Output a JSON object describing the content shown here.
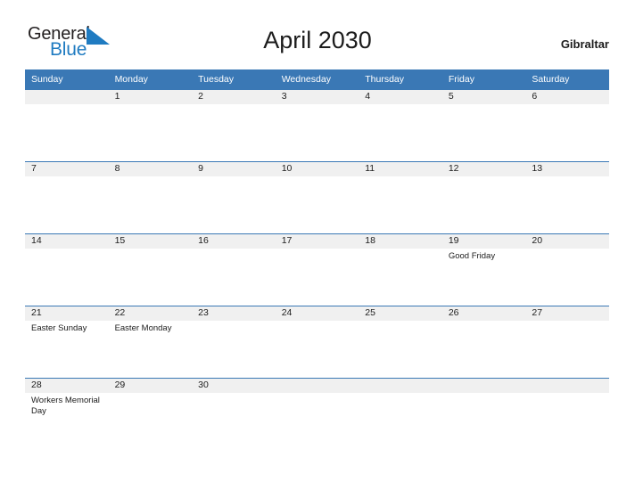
{
  "brand": {
    "line1": "General",
    "line2": "Blue",
    "mark_icon": "flag-triangle-icon",
    "line1_color": "#231f20",
    "line2_color": "#1f7bc1",
    "mark_color": "#1f7bc1"
  },
  "header": {
    "title": "April 2030",
    "location": "Gibraltar"
  },
  "theme": {
    "header_blue": "#3a78b5",
    "date_band_gray": "#f0f0f0",
    "text_dark": "#1c1c1c",
    "page_background": "#ffffff"
  },
  "calendar": {
    "weekday_headers": [
      "Sunday",
      "Monday",
      "Tuesday",
      "Wednesday",
      "Thursday",
      "Friday",
      "Saturday"
    ],
    "weeks": [
      [
        {
          "day": "",
          "events": []
        },
        {
          "day": "1",
          "events": []
        },
        {
          "day": "2",
          "events": []
        },
        {
          "day": "3",
          "events": []
        },
        {
          "day": "4",
          "events": []
        },
        {
          "day": "5",
          "events": []
        },
        {
          "day": "6",
          "events": []
        }
      ],
      [
        {
          "day": "7",
          "events": []
        },
        {
          "day": "8",
          "events": []
        },
        {
          "day": "9",
          "events": []
        },
        {
          "day": "10",
          "events": []
        },
        {
          "day": "11",
          "events": []
        },
        {
          "day": "12",
          "events": []
        },
        {
          "day": "13",
          "events": []
        }
      ],
      [
        {
          "day": "14",
          "events": []
        },
        {
          "day": "15",
          "events": []
        },
        {
          "day": "16",
          "events": []
        },
        {
          "day": "17",
          "events": []
        },
        {
          "day": "18",
          "events": []
        },
        {
          "day": "19",
          "events": [
            "Good Friday"
          ]
        },
        {
          "day": "20",
          "events": []
        }
      ],
      [
        {
          "day": "21",
          "events": [
            "Easter Sunday"
          ]
        },
        {
          "day": "22",
          "events": [
            "Easter Monday"
          ]
        },
        {
          "day": "23",
          "events": []
        },
        {
          "day": "24",
          "events": []
        },
        {
          "day": "25",
          "events": []
        },
        {
          "day": "26",
          "events": []
        },
        {
          "day": "27",
          "events": []
        }
      ],
      [
        {
          "day": "28",
          "events": [
            "Workers Memorial Day"
          ]
        },
        {
          "day": "29",
          "events": []
        },
        {
          "day": "30",
          "events": []
        },
        {
          "day": "",
          "events": []
        },
        {
          "day": "",
          "events": []
        },
        {
          "day": "",
          "events": []
        },
        {
          "day": "",
          "events": []
        }
      ]
    ]
  }
}
